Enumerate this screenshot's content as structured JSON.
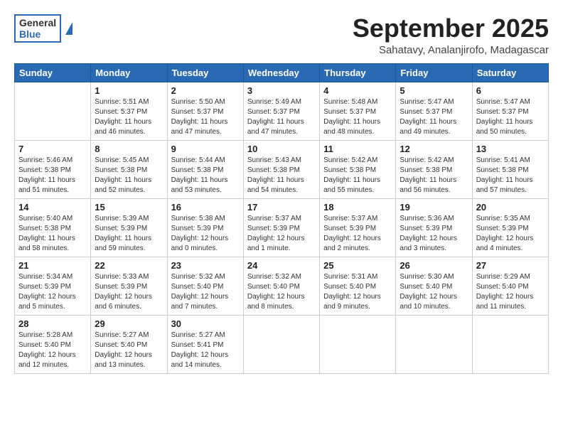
{
  "header": {
    "logo_general": "General",
    "logo_blue": "Blue",
    "title": "September 2025",
    "subtitle": "Sahatavy, Analanjirofo, Madagascar"
  },
  "days_of_week": [
    "Sunday",
    "Monday",
    "Tuesday",
    "Wednesday",
    "Thursday",
    "Friday",
    "Saturday"
  ],
  "weeks": [
    [
      {
        "day": "",
        "info": ""
      },
      {
        "day": "1",
        "info": "Sunrise: 5:51 AM\nSunset: 5:37 PM\nDaylight: 11 hours\nand 46 minutes."
      },
      {
        "day": "2",
        "info": "Sunrise: 5:50 AM\nSunset: 5:37 PM\nDaylight: 11 hours\nand 47 minutes."
      },
      {
        "day": "3",
        "info": "Sunrise: 5:49 AM\nSunset: 5:37 PM\nDaylight: 11 hours\nand 47 minutes."
      },
      {
        "day": "4",
        "info": "Sunrise: 5:48 AM\nSunset: 5:37 PM\nDaylight: 11 hours\nand 48 minutes."
      },
      {
        "day": "5",
        "info": "Sunrise: 5:47 AM\nSunset: 5:37 PM\nDaylight: 11 hours\nand 49 minutes."
      },
      {
        "day": "6",
        "info": "Sunrise: 5:47 AM\nSunset: 5:37 PM\nDaylight: 11 hours\nand 50 minutes."
      }
    ],
    [
      {
        "day": "7",
        "info": "Sunrise: 5:46 AM\nSunset: 5:38 PM\nDaylight: 11 hours\nand 51 minutes."
      },
      {
        "day": "8",
        "info": "Sunrise: 5:45 AM\nSunset: 5:38 PM\nDaylight: 11 hours\nand 52 minutes."
      },
      {
        "day": "9",
        "info": "Sunrise: 5:44 AM\nSunset: 5:38 PM\nDaylight: 11 hours\nand 53 minutes."
      },
      {
        "day": "10",
        "info": "Sunrise: 5:43 AM\nSunset: 5:38 PM\nDaylight: 11 hours\nand 54 minutes."
      },
      {
        "day": "11",
        "info": "Sunrise: 5:42 AM\nSunset: 5:38 PM\nDaylight: 11 hours\nand 55 minutes."
      },
      {
        "day": "12",
        "info": "Sunrise: 5:42 AM\nSunset: 5:38 PM\nDaylight: 11 hours\nand 56 minutes."
      },
      {
        "day": "13",
        "info": "Sunrise: 5:41 AM\nSunset: 5:38 PM\nDaylight: 11 hours\nand 57 minutes."
      }
    ],
    [
      {
        "day": "14",
        "info": "Sunrise: 5:40 AM\nSunset: 5:38 PM\nDaylight: 11 hours\nand 58 minutes."
      },
      {
        "day": "15",
        "info": "Sunrise: 5:39 AM\nSunset: 5:39 PM\nDaylight: 11 hours\nand 59 minutes."
      },
      {
        "day": "16",
        "info": "Sunrise: 5:38 AM\nSunset: 5:39 PM\nDaylight: 12 hours\nand 0 minutes."
      },
      {
        "day": "17",
        "info": "Sunrise: 5:37 AM\nSunset: 5:39 PM\nDaylight: 12 hours\nand 1 minute."
      },
      {
        "day": "18",
        "info": "Sunrise: 5:37 AM\nSunset: 5:39 PM\nDaylight: 12 hours\nand 2 minutes."
      },
      {
        "day": "19",
        "info": "Sunrise: 5:36 AM\nSunset: 5:39 PM\nDaylight: 12 hours\nand 3 minutes."
      },
      {
        "day": "20",
        "info": "Sunrise: 5:35 AM\nSunset: 5:39 PM\nDaylight: 12 hours\nand 4 minutes."
      }
    ],
    [
      {
        "day": "21",
        "info": "Sunrise: 5:34 AM\nSunset: 5:39 PM\nDaylight: 12 hours\nand 5 minutes."
      },
      {
        "day": "22",
        "info": "Sunrise: 5:33 AM\nSunset: 5:39 PM\nDaylight: 12 hours\nand 6 minutes."
      },
      {
        "day": "23",
        "info": "Sunrise: 5:32 AM\nSunset: 5:40 PM\nDaylight: 12 hours\nand 7 minutes."
      },
      {
        "day": "24",
        "info": "Sunrise: 5:32 AM\nSunset: 5:40 PM\nDaylight: 12 hours\nand 8 minutes."
      },
      {
        "day": "25",
        "info": "Sunrise: 5:31 AM\nSunset: 5:40 PM\nDaylight: 12 hours\nand 9 minutes."
      },
      {
        "day": "26",
        "info": "Sunrise: 5:30 AM\nSunset: 5:40 PM\nDaylight: 12 hours\nand 10 minutes."
      },
      {
        "day": "27",
        "info": "Sunrise: 5:29 AM\nSunset: 5:40 PM\nDaylight: 12 hours\nand 11 minutes."
      }
    ],
    [
      {
        "day": "28",
        "info": "Sunrise: 5:28 AM\nSunset: 5:40 PM\nDaylight: 12 hours\nand 12 minutes."
      },
      {
        "day": "29",
        "info": "Sunrise: 5:27 AM\nSunset: 5:40 PM\nDaylight: 12 hours\nand 13 minutes."
      },
      {
        "day": "30",
        "info": "Sunrise: 5:27 AM\nSunset: 5:41 PM\nDaylight: 12 hours\nand 14 minutes."
      },
      {
        "day": "",
        "info": ""
      },
      {
        "day": "",
        "info": ""
      },
      {
        "day": "",
        "info": ""
      },
      {
        "day": "",
        "info": ""
      }
    ]
  ]
}
